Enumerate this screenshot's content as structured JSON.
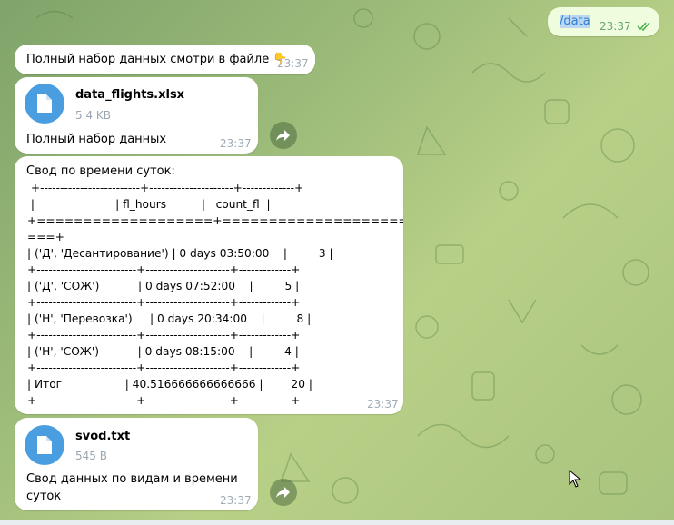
{
  "outgoing": {
    "command": "/data",
    "time": "23:37"
  },
  "messages": {
    "intro": {
      "text": "Полный набор данных смотри в файле 👇",
      "time": "23:37"
    },
    "file1": {
      "name": "data_flights.xlsx",
      "size": "5.4 KB",
      "caption": "Полный набор данных",
      "time": "23:37"
    },
    "svod": {
      "title": "Свод по времени суток:",
      "lines": [
        " +-------------------------+---------------------+-------------+",
        " |                       | fl_hours          |   count_fl  |",
        "+===================+=====================+==========",
        "===+",
        "| ('Д', 'Десантирование') | 0 days 03:50:00    |         3 |",
        "+-------------------------+---------------------+-------------+",
        "| ('Д', 'СОЖ')           | 0 days 07:52:00    |         5 |",
        "+-------------------------+---------------------+-------------+",
        "| ('Н', 'Перевозка')     | 0 days 20:34:00    |         8 |",
        "+-------------------------+---------------------+-------------+",
        "| ('Н', 'СОЖ')           | 0 days 08:15:00    |         4 |",
        "+-------------------------+---------------------+-------------+",
        "| Итог                  | 40.516666666666666 |        20 |",
        "+-------------------------+---------------------+-------------+"
      ],
      "time": "23:37"
    },
    "file2": {
      "name": "svod.txt",
      "size": "545 B",
      "caption_line1": "Свод данных по видам и времени",
      "caption_line2": "суток",
      "time": "23:37"
    }
  },
  "icons": {
    "file": "file-icon",
    "share": "share-icon",
    "read": "double-check-icon",
    "cursor": "mouse-cursor-icon"
  },
  "colors": {
    "accent": "#4a9ee0",
    "outgoing_bubble": "#effdde",
    "incoming_bubble": "#ffffff"
  }
}
